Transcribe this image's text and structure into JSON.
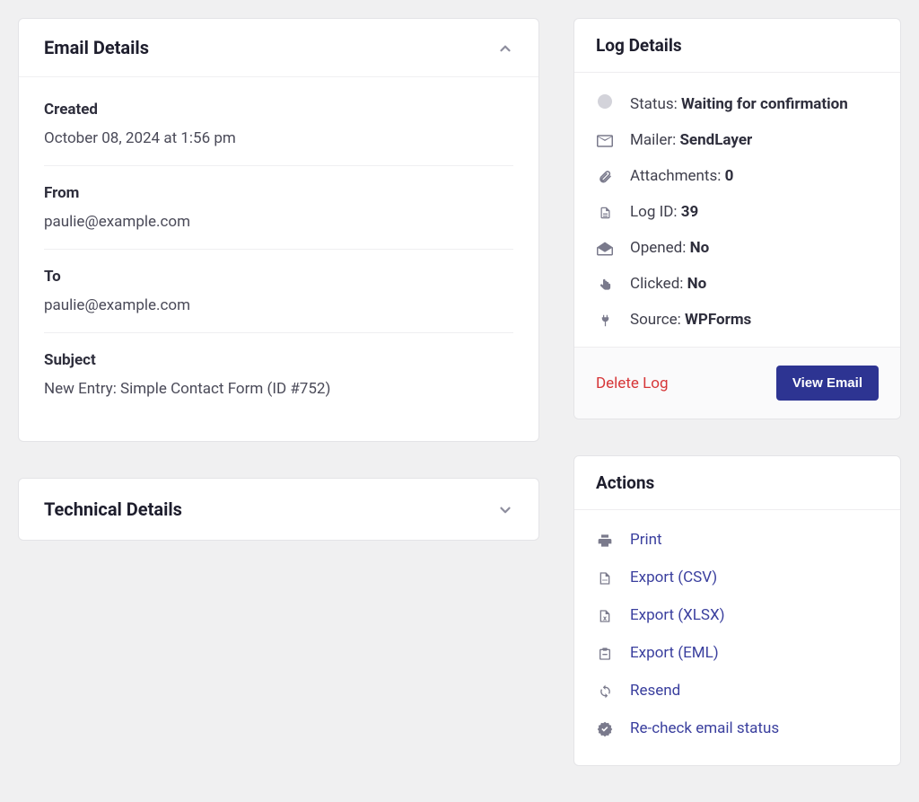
{
  "email_details": {
    "title": "Email Details",
    "created": {
      "label": "Created",
      "value": "October 08, 2024 at 1:56 pm"
    },
    "from": {
      "label": "From",
      "value": "paulie@example.com"
    },
    "to": {
      "label": "To",
      "value": "paulie@example.com"
    },
    "subject": {
      "label": "Subject",
      "value": "New Entry: Simple Contact Form (ID #752)"
    }
  },
  "technical_details": {
    "title": "Technical Details"
  },
  "log_details": {
    "title": "Log Details",
    "status": {
      "label": "Status: ",
      "value": "Waiting for confirmation"
    },
    "mailer": {
      "label": "Mailer: ",
      "value": "SendLayer"
    },
    "attachments": {
      "label": "Attachments: ",
      "value": "0"
    },
    "log_id": {
      "label": "Log ID: ",
      "value": "39"
    },
    "opened": {
      "label": "Opened: ",
      "value": "No"
    },
    "clicked": {
      "label": "Clicked: ",
      "value": "No"
    },
    "source": {
      "label": "Source: ",
      "value": "WPForms"
    },
    "delete_label": "Delete Log",
    "view_label": "View Email"
  },
  "actions": {
    "title": "Actions",
    "items": [
      {
        "label": "Print"
      },
      {
        "label": "Export (CSV)"
      },
      {
        "label": "Export (XLSX)"
      },
      {
        "label": "Export (EML)"
      },
      {
        "label": "Resend"
      },
      {
        "label": "Re-check email status"
      }
    ]
  }
}
